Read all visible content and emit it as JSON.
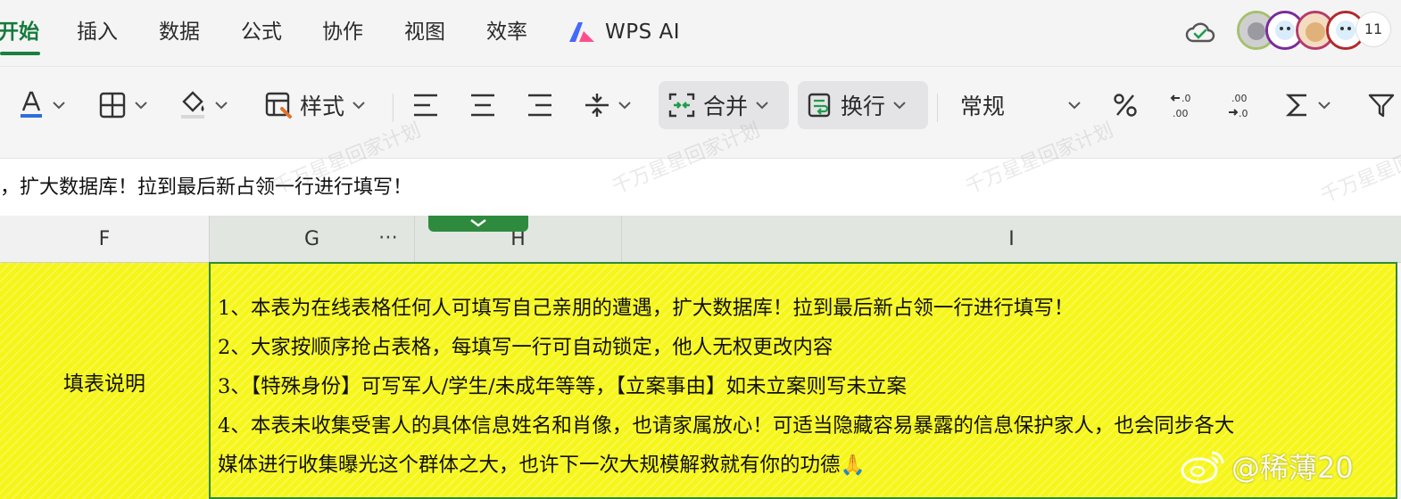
{
  "menu": {
    "tabs": [
      {
        "label": "开始",
        "active": true
      },
      {
        "label": "插入"
      },
      {
        "label": "数据"
      },
      {
        "label": "公式"
      },
      {
        "label": "协作"
      },
      {
        "label": "视图"
      },
      {
        "label": "效率"
      }
    ],
    "wps_ai_label": "WPS AI",
    "collaborator_count": "11"
  },
  "toolbar": {
    "style_label": "样式",
    "merge_label": "合并",
    "wrap_label": "换行",
    "number_format": "常规",
    "icons": [
      "font-color-icon",
      "borders-icon",
      "fill-color-icon",
      "style-icon",
      "align-left-icon",
      "align-center-icon",
      "align-right-icon",
      "vertical-align-icon",
      "merge-icon",
      "wrap-icon",
      "percent-icon",
      "decrease-decimal-icon",
      "increase-decimal-icon",
      "sum-icon",
      "filter-icon"
    ]
  },
  "formula_bar": {
    "text": "，扩大数据库！拉到最后新占领一行进行填写！"
  },
  "columns": [
    "F",
    "G",
    "H",
    "I"
  ],
  "cells": {
    "f_label": "填表说明",
    "instructions": [
      "1、本表为在线表格任何人可填写自己亲朋的遭遇，扩大数据库！拉到最后新占领一行进行填写！",
      "2、大家按顺序抢占表格，每填写一行可自动锁定，他人无权更改内容",
      "3、【特殊身份】可写军人/学生/未成年等等，【立案事由】如未立案则写未立案",
      "4、本表未收集受害人的具体信息姓名和肖像，也请家属放心！可适当隐藏容易暴露的信息保护家人，也会同步各大",
      "媒体进行收集曝光这个群体之大，也许下一次大规模解救就有你的功德🙏"
    ]
  },
  "watermark": {
    "text": "千万星星回家计划",
    "weibo_handle": "@稀薄20"
  },
  "colors": {
    "accent_green": "#1a7f41",
    "cell_yellow": "#f6f61a",
    "selection_border": "#2f8a3c"
  }
}
